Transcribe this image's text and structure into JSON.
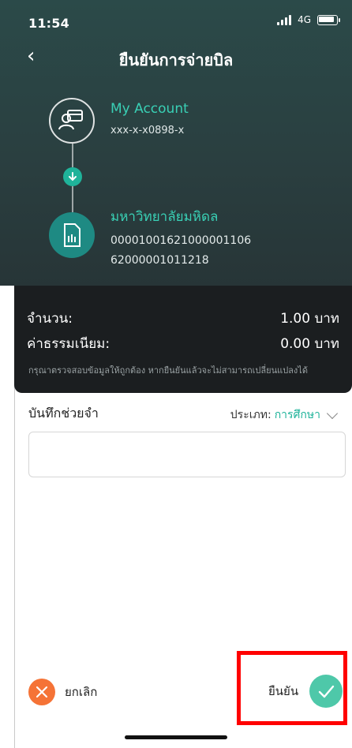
{
  "status_bar": {
    "time": "11:54",
    "network": "4G"
  },
  "nav": {
    "title": "ยืนยันการจ่ายบิล"
  },
  "from_account": {
    "name": "My Account",
    "number": "xxx-x-x0898-x"
  },
  "biller": {
    "name": "มหาวิทยาลัยมหิดล",
    "ref1": "0000100162100000​1106",
    "ref2": "62000001011218"
  },
  "summary": {
    "amount_label": "จำนวน:",
    "amount_value": "1.00 บาท",
    "fee_label": "ค่าธรรมเนียม:",
    "fee_value": "0.00 บาท",
    "note": "กรุณาตรวจสอบข้อมูลให้ถูกต้อง หากยืนยันแล้วจะไม่สามารถเปลี่ยนแปลงได้"
  },
  "memo": {
    "label": "บันทึกช่วยจำ",
    "type_label": "ประเภท:",
    "type_value": "การศึกษา",
    "value": ""
  },
  "actions": {
    "cancel_label": "ยกเลิก",
    "confirm_label": "ยืนยัน"
  },
  "colors": {
    "accent": "#1fb39a",
    "cancel": "#f57336",
    "confirm": "#4ec8a9",
    "highlight": "#ff0000"
  }
}
